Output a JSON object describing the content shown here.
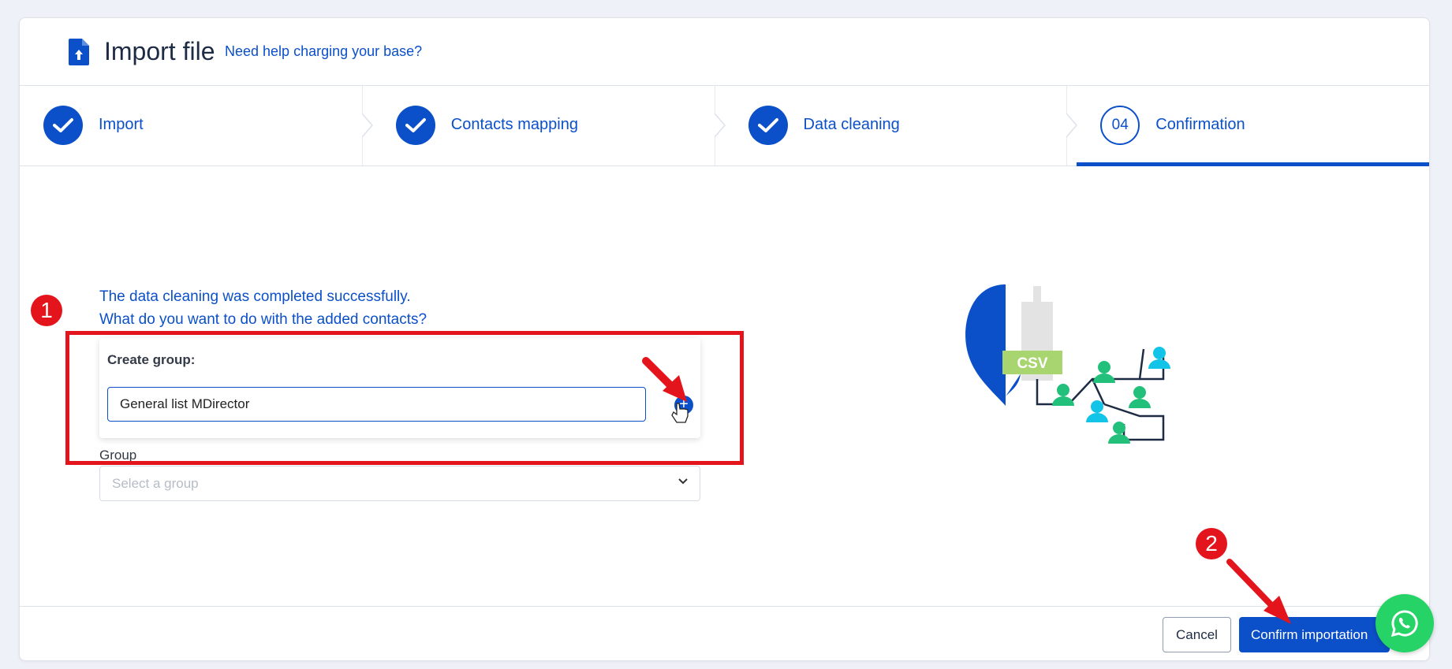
{
  "header": {
    "title": "Import file",
    "help_link": "Need help charging your base?"
  },
  "steps": [
    {
      "label": "Import",
      "state": "completed"
    },
    {
      "label": "Contacts mapping",
      "state": "completed"
    },
    {
      "label": "Data cleaning",
      "state": "completed"
    },
    {
      "label": "Confirmation",
      "number": "04",
      "state": "active"
    }
  ],
  "content": {
    "message_line1": "The data cleaning was completed successfully.",
    "message_line2": "What do you want to do with the added contacts?",
    "create_group_label": "Create group:",
    "create_group_value": "General list MDirector",
    "add_button": "+",
    "group_label": "Group",
    "group_placeholder": "Select a group"
  },
  "illustration": {
    "csv_label": "CSV"
  },
  "footer": {
    "cancel_label": "Cancel",
    "confirm_label": "Confirm importation"
  },
  "annotations": {
    "badge1": "1",
    "badge2": "2"
  },
  "colors": {
    "primary": "#0b50c8",
    "annotation_red": "#e3141b",
    "whatsapp_green": "#25d366",
    "contact_green": "#22c07a",
    "contact_cyan": "#12c4e8",
    "csv_green": "#a8d56f"
  }
}
